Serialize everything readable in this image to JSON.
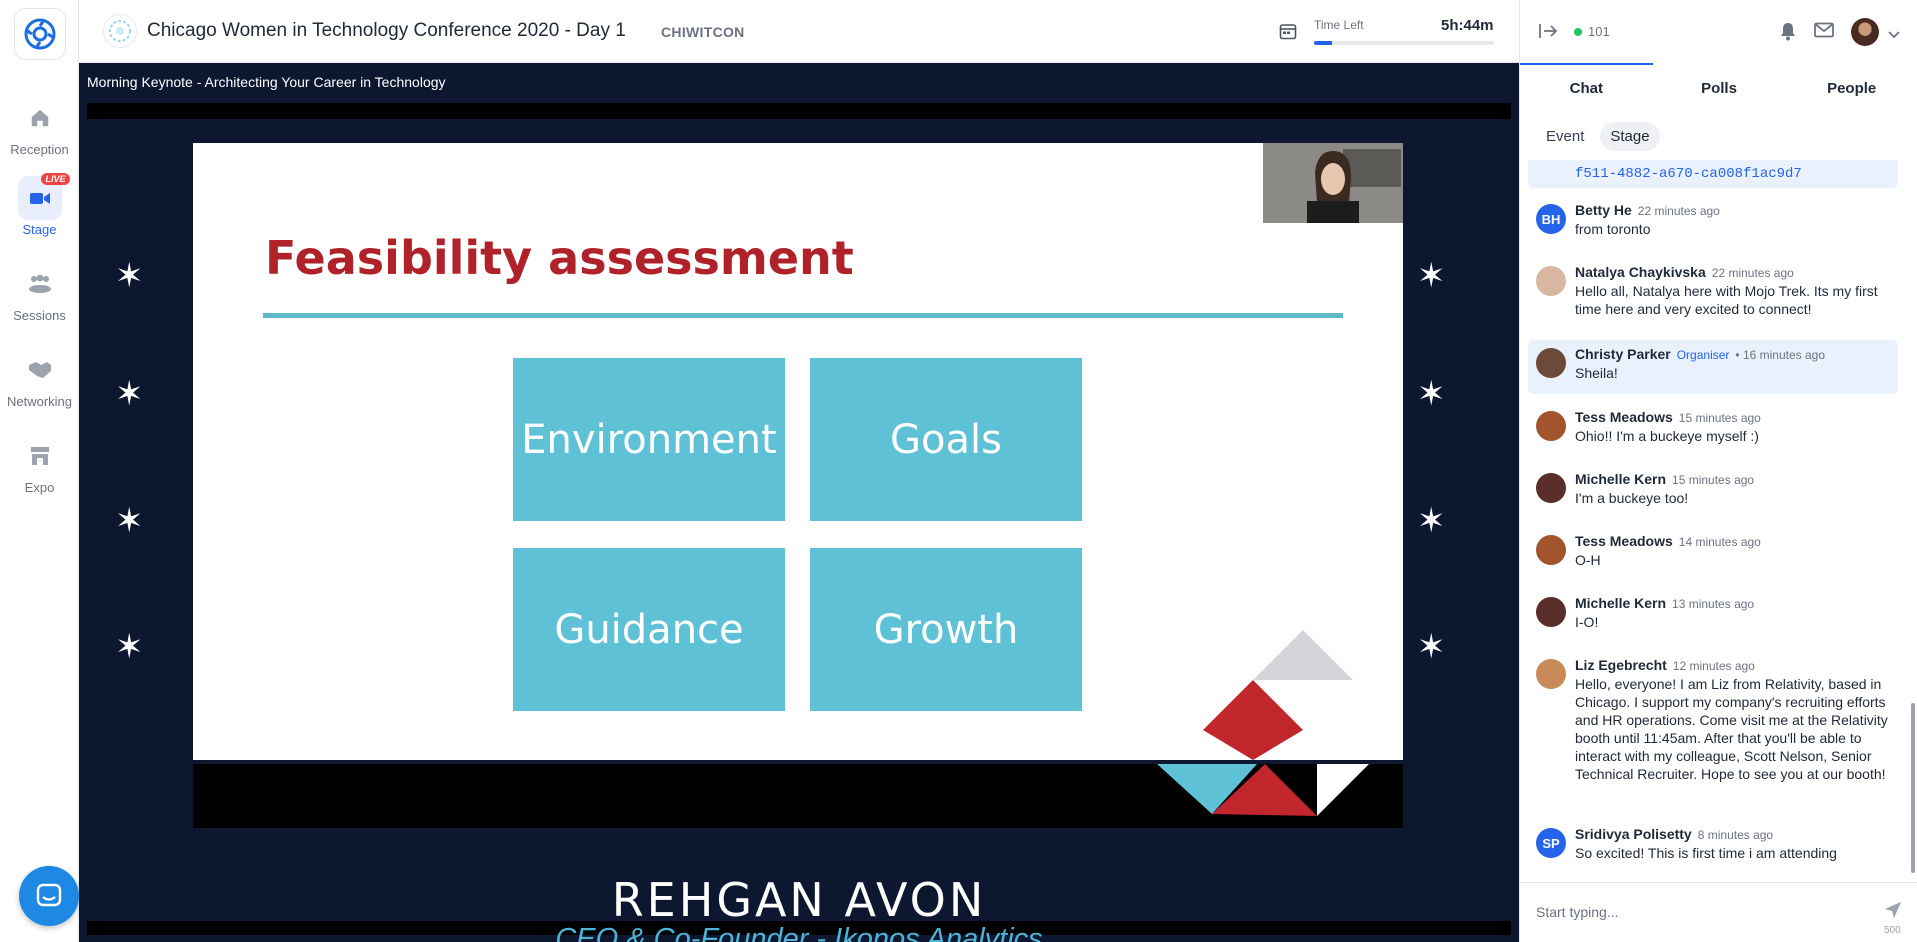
{
  "app": {
    "nav": [
      {
        "label": "Reception",
        "icon": "home-icon"
      },
      {
        "label": "Stage",
        "icon": "video-camera-icon",
        "active": true,
        "badge": "LIVE"
      },
      {
        "label": "Sessions",
        "icon": "people-group-icon"
      },
      {
        "label": "Networking",
        "icon": "handshake-icon"
      },
      {
        "label": "Expo",
        "icon": "store-icon"
      }
    ]
  },
  "header": {
    "event_title": "Chicago Women in Technology Conference 2020 - Day 1",
    "event_code": "CHIWITCON",
    "time_left_label": "Time Left",
    "time_left_value": "5h:44m",
    "time_progress": 0.1
  },
  "stage": {
    "session_title": "Morning Keynote - Architecting Your Career in Technology",
    "slide": {
      "title": "Feasibility assessment",
      "tiles": [
        "Environment",
        "Goals",
        "Guidance",
        "Growth"
      ]
    },
    "speaker_name": "REHGAN AVON",
    "speaker_role": "CEO & Co-Founder - Ikonos Analytics"
  },
  "panel": {
    "online_count": "101",
    "tabs": [
      "Chat",
      "Polls",
      "People"
    ],
    "active_tab": "Chat",
    "subtabs": [
      "Event",
      "Stage"
    ],
    "active_subtab": "Stage",
    "link_fragment": "f511-4882-a670-ca008f1ac9d7",
    "messages": [
      {
        "name": "Betty He",
        "initials": "BH",
        "avatar_color": "#2563eb",
        "time": "22 minutes ago",
        "text": "from toronto"
      },
      {
        "name": "Natalya Chaykivska",
        "initials": "",
        "avatar_color": "#d8b7a0",
        "time": "22 minutes ago",
        "text": "Hello all, Natalya here with Mojo Trek. Its my first time here and very excited to connect!"
      },
      {
        "name": "Christy Parker",
        "initials": "",
        "avatar_color": "#6b4a3a",
        "role": "Organiser",
        "time": "• 16 minutes ago",
        "text": "Sheila!",
        "highlight": true
      },
      {
        "name": "Tess Meadows",
        "initials": "",
        "avatar_color": "#a0552f",
        "time": "15 minutes ago",
        "text": "Ohio!! I'm a buckeye myself :)"
      },
      {
        "name": "Michelle Kern",
        "initials": "",
        "avatar_color": "#5a2e2a",
        "time": "15 minutes ago",
        "text": "I'm a buckeye too!"
      },
      {
        "name": "Tess Meadows",
        "initials": "",
        "avatar_color": "#a0552f",
        "time": "14 minutes ago",
        "text": "O-H"
      },
      {
        "name": "Michelle Kern",
        "initials": "",
        "avatar_color": "#5a2e2a",
        "time": "13 minutes ago",
        "text": "I-O!"
      },
      {
        "name": "Liz Egebrecht",
        "initials": "",
        "avatar_color": "#c98a5a",
        "time": "12 minutes ago",
        "text": "Hello, everyone! I am Liz from Relativity, based in Chicago. I support my company's recruiting efforts and HR operations. Come visit me at the Relativity booth until 11:45am. After that you'll be able to interact with my colleague, Scott Nelson, Senior Technical Recruiter. Hope to see you at our booth!"
      },
      {
        "name": "Sridivya Polisetty",
        "initials": "SP",
        "avatar_color": "#2563eb",
        "time": "8 minutes ago",
        "text": "So excited! This is first time i am attending"
      }
    ],
    "composer_placeholder": "Start typing...",
    "char_limit": "500"
  }
}
